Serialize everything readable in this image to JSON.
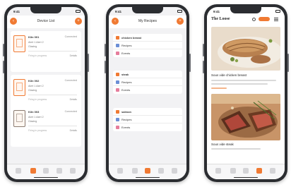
{
  "phones": [
    {
      "screen": "device-list",
      "status_time": "9:41",
      "nav_title": "Device List",
      "devices": [
        {
          "name": "Kiln 001",
          "status": "Connected",
          "meta1": "Alert 1   Alert 2",
          "meta2": "Glazing",
          "foot_left": "Firing in progress",
          "foot_right": "Details"
        },
        {
          "name": "Kiln 002",
          "status": "Connected",
          "meta1": "Alert 1   Alert 2",
          "meta2": "Glazing",
          "foot_left": "Firing in progress",
          "foot_right": "Details"
        },
        {
          "name": "Kiln 003",
          "status": "Connected",
          "meta1": "Alert 1   Alert 2",
          "meta2": "Glazing",
          "foot_left": "Firing in progress",
          "foot_right": "Details"
        }
      ]
    },
    {
      "screen": "my-recipes",
      "status_time": "9:41",
      "nav_title": "My Recipes",
      "groups": [
        {
          "items": [
            "chicken breast",
            "Recipes",
            "Events"
          ]
        },
        {
          "items": [
            "steak",
            "Recipes",
            "Events"
          ]
        },
        {
          "items": [
            "salmon",
            "Recipes",
            "Events"
          ]
        }
      ]
    },
    {
      "screen": "recipe-article",
      "status_time": "9:41",
      "brand": "The Loose",
      "captions": [
        "Sous vide chicken breast",
        "Sous vide steak"
      ]
    }
  ],
  "colors": {
    "accent": "#f07a33",
    "screen_bg": "#f2f2f4",
    "frame": "#2b2d31"
  }
}
